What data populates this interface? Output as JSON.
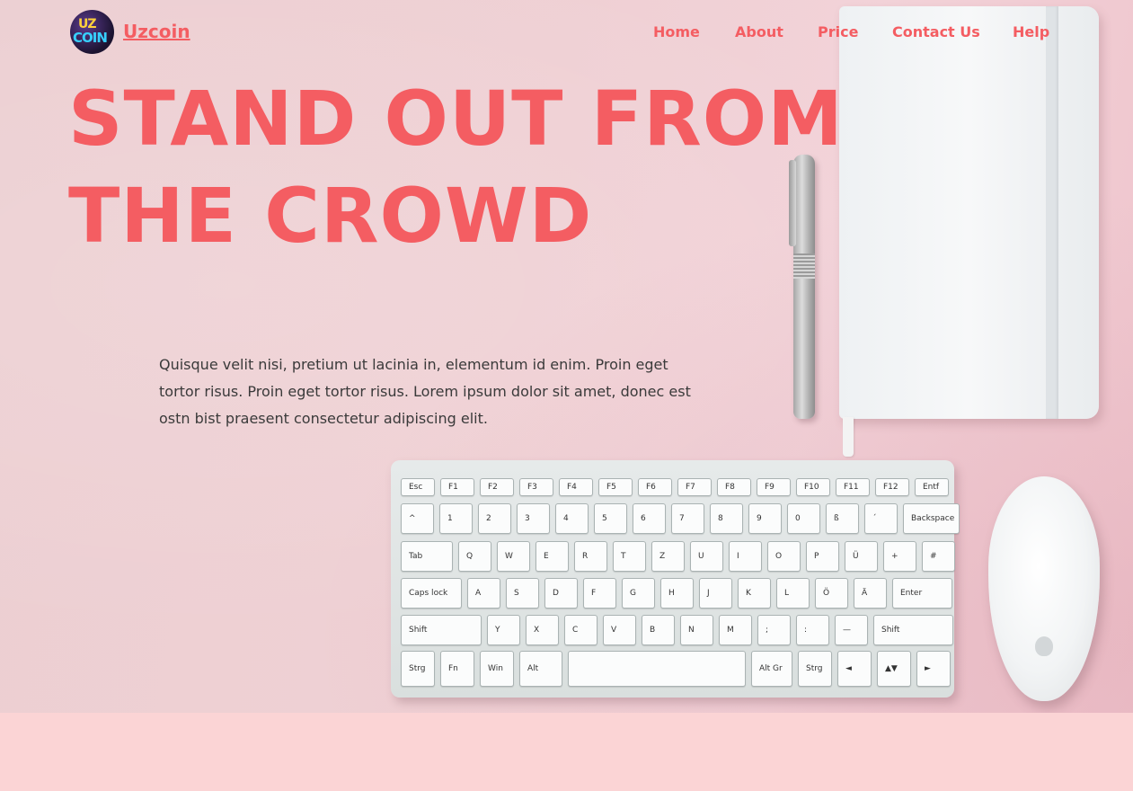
{
  "brand": {
    "name": "Uzcoin",
    "logo_text_top": "UZ",
    "logo_text_bottom": "COIN"
  },
  "nav": {
    "items": [
      "Home",
      "About",
      "Price",
      "Contact Us",
      "Help"
    ]
  },
  "hero": {
    "headline_line1": "STAND OUT FROM",
    "headline_line2": "THE CROWD",
    "body": "Quisque velit nisi, pretium ut lacinia in, elementum id enim. Proin eget tortor risus. Proin eget tortor risus. Lorem ipsum dolor sit amet, donec est ostn bist praesent consectetur adipiscing elit."
  },
  "keyboard": {
    "row1": [
      "Esc",
      "F1",
      "F2",
      "F3",
      "F4",
      "F5",
      "F6",
      "F7",
      "F8",
      "F9",
      "F10",
      "F11",
      "F12",
      "Entf"
    ],
    "row2": [
      "^",
      "1",
      "2",
      "3",
      "4",
      "5",
      "6",
      "7",
      "8",
      "9",
      "0",
      "ß",
      "´",
      "Backspace"
    ],
    "row3": [
      "Tab",
      "Q",
      "W",
      "E",
      "R",
      "T",
      "Z",
      "U",
      "I",
      "O",
      "P",
      "Ü",
      "+",
      "#"
    ],
    "row4": [
      "Caps lock",
      "A",
      "S",
      "D",
      "F",
      "G",
      "H",
      "J",
      "K",
      "L",
      "Ö",
      "Ä",
      "Enter"
    ],
    "row5": [
      "Shift",
      "Y",
      "X",
      "C",
      "V",
      "B",
      "N",
      "M",
      ";",
      ":",
      "—",
      "Shift"
    ],
    "row6": [
      "Strg",
      "Fn",
      "Win",
      "Alt",
      "",
      "Alt Gr",
      "Strg",
      "◄",
      "▲▼",
      "►"
    ]
  },
  "colors": {
    "accent": "#f45d62",
    "hero_bg": "#efd0d4",
    "page_bg": "#fbd4d5",
    "body_text": "#3a3a3a"
  }
}
